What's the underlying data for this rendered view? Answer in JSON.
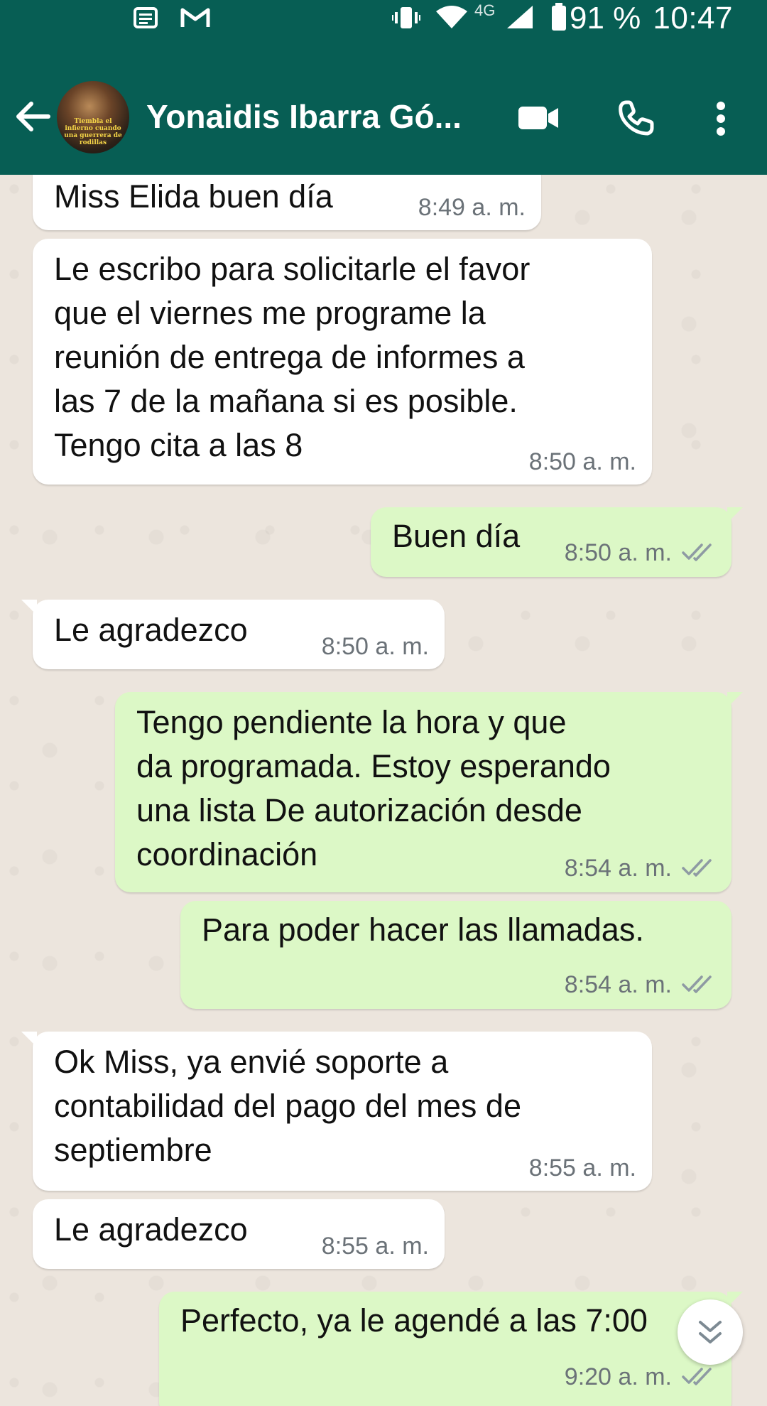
{
  "status_bar": {
    "battery_percent": "91 %",
    "time": "10:47",
    "network": "4G",
    "icons": [
      "news-icon",
      "gmail-icon",
      "vibrate-icon",
      "wifi-icon",
      "signal-icon",
      "battery-icon"
    ]
  },
  "header": {
    "contact_name": "Yonaidis Ibarra Gó...",
    "avatar_caption": "Tiembla el infierno cuando una guerrera de rodillas",
    "icons": [
      "back-arrow-icon",
      "video-call-icon",
      "phone-icon",
      "more-vert-icon"
    ]
  },
  "messages": [
    {
      "direction": "in",
      "text": "Miss Elida buen día",
      "time": "8:49 a. m."
    },
    {
      "direction": "in",
      "text": "Le escribo para solicitarle el favor\nque el viernes me programe la\nreunión de entrega de informes a\nlas 7 de la mañana si es posible.\nTengo cita a las 8",
      "time": "8:50 a. m."
    },
    {
      "direction": "out",
      "text": "Buen día",
      "time": "8:50 a. m.",
      "status": "read"
    },
    {
      "direction": "in",
      "text": "Le agradezco",
      "time": "8:50 a. m."
    },
    {
      "direction": "out",
      "text": "Tengo pendiente la hora y que\nda programada. Estoy esperando\nuna lista De autorización desde\ncoordinación",
      "time": "8:54 a. m.",
      "status": "read"
    },
    {
      "direction": "out",
      "text": "Para poder hacer las llamadas.",
      "time": "8:54 a. m.",
      "status": "read"
    },
    {
      "direction": "in",
      "text": "Ok Miss, ya envié soporte a\ncontabilidad del pago del mes de\nseptiembre",
      "time": "8:55 a. m."
    },
    {
      "direction": "in",
      "text": "Le agradezco",
      "time": "8:55 a. m."
    },
    {
      "direction": "out",
      "text": "Perfecto, ya le agendé a las 7:00",
      "time": "9:20 a. m.",
      "status": "read"
    }
  ],
  "colors": {
    "header": "#075e54",
    "chat_background": "#ece5dd",
    "incoming_bubble": "#ffffff",
    "outgoing_bubble": "#dcf8c6",
    "read_ticks": "#8e9aa3"
  }
}
